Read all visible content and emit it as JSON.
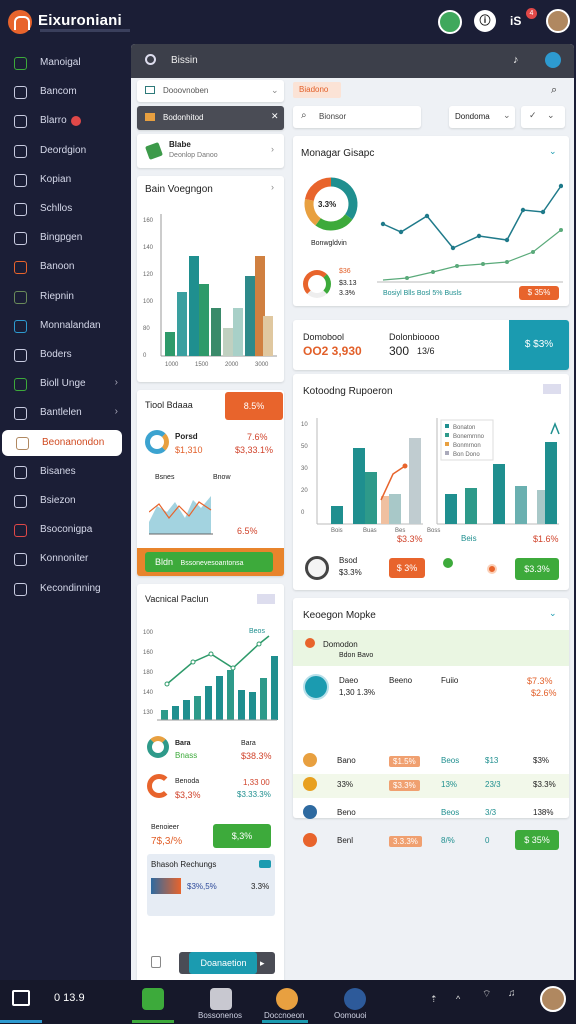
{
  "app": {
    "title": "Eixuroniani"
  },
  "topbar": {
    "notif_count": "4",
    "user_short": "iS"
  },
  "sidebar": {
    "items": [
      {
        "label": "Manoigal",
        "icon": "globe-icon"
      },
      {
        "label": "Bancom",
        "icon": "home-icon"
      },
      {
        "label": "Blarro",
        "icon": "clock-icon",
        "badge": true
      },
      {
        "label": "Deordgion",
        "icon": "pen-icon"
      },
      {
        "label": "Kopian",
        "icon": "document-icon"
      },
      {
        "label": "Schllos",
        "icon": "folder-icon"
      },
      {
        "label": "Bingpgen",
        "icon": "settings-icon"
      },
      {
        "label": "Banoon",
        "icon": "tag-icon"
      },
      {
        "label": "Riepnin",
        "icon": "image-icon"
      },
      {
        "label": "Monnalandan",
        "icon": "chat-icon"
      },
      {
        "label": "Boders",
        "icon": "calendar-icon"
      },
      {
        "label": "Bioll Unge",
        "icon": "leaf-icon",
        "chevron": true
      },
      {
        "label": "Bantlelen",
        "icon": "edit-icon",
        "chevron": true
      },
      {
        "label": "Beonanondon",
        "icon": "user-icon",
        "active": true
      },
      {
        "label": "Bisanes",
        "icon": "face-icon"
      },
      {
        "label": "Bsiezon",
        "icon": "bell-icon"
      },
      {
        "label": "Bsoconigpa",
        "icon": "cart-icon"
      },
      {
        "label": "Konnoniter",
        "icon": "chart-icon"
      },
      {
        "label": "Kecondinning",
        "icon": "share-icon"
      }
    ]
  },
  "search": {
    "placeholder": "Bissin"
  },
  "left": {
    "dropdown1": "Dooovnoben",
    "dropdown2": "Bodonhitod",
    "item": {
      "title": "Blabe",
      "sub": "Deonlop Danoo"
    },
    "chart1": {
      "title": "Bain Voegngon",
      "yticks": [
        "160",
        "140",
        "120",
        "100",
        "80",
        "0"
      ],
      "xticks": [
        "1000",
        "1500",
        "2000",
        "3000"
      ]
    },
    "card2": {
      "title": "Tiool Bdaaa",
      "tag": "8.5%",
      "name": "Porsd",
      "v1": "7.6%",
      "val": "$1,310",
      "v2": "$3,33.1%",
      "lbl1": "Bsnes",
      "lbl2": "Bnow",
      "pct": "6.5%",
      "btn_a": "Bldn",
      "btn_b": "Bssonevesoantonsa"
    },
    "card3": {
      "title": "Vacnical Paclun",
      "legend": "Beos",
      "yticks": [
        "100",
        "160",
        "180",
        "140",
        "130"
      ],
      "r1_label": "Bara",
      "r1_val": "Bnass",
      "r1_pct": "$38.3%",
      "r2_label": "Benoda",
      "r2_v": "1,33 00",
      "r2_val": "$3,3%",
      "r2_pct": "$3.33.3%",
      "r3_label": "Benoieer",
      "r3_val": "7$,3/%",
      "r3_btn": "$,3%",
      "sub_title": "Bhasoh Rechungs",
      "sub_v1": "$3%,5%",
      "sub_v2": "3.3%",
      "btn": "Doanaetion"
    }
  },
  "right": {
    "tab": "Biadono",
    "filter": "Dondoma",
    "search": "Bionsor",
    "card1": {
      "title": "Monagar Gisapc",
      "donut_pct": "3.3%",
      "donut_label": "Bonwgldvin",
      "mini_vals": [
        "$36",
        "$3.13",
        "3.3%"
      ],
      "legend": "Bosiyl Blls Bosl 5% Busls",
      "btn": "$ 35%"
    },
    "card2": {
      "l1": "Domobool",
      "v1": "OO2 3,930",
      "l2": "Dolonbioooo",
      "v2": "300",
      "v3": "13/6",
      "btn": "$ $3%"
    },
    "card3": {
      "title": "Kotoodng Rupoeron",
      "yticks": [
        "10",
        "50",
        "30",
        "20",
        "0"
      ],
      "xticks": [
        "Bois",
        "Buas",
        "Bes",
        "Boss"
      ],
      "legend": [
        "Bonaton",
        "Bonemrnno",
        "Bonmrnon",
        "Bon Dono"
      ],
      "pct_a": "$3.3%",
      "pct_b": "Beis",
      "pct_c": "$1.6%",
      "row": {
        "name": "Bsod",
        "val": "$3.3%",
        "btn1": "$ 3%",
        "btn2": "$3.3%"
      }
    },
    "card4": {
      "title": "Keoegon Mopke",
      "header": "Domodon",
      "sub": "Bdon Bavo",
      "row1": {
        "c1": "Daeo",
        "c2": "Beeno",
        "c3": "Fuiio",
        "c4": "$7.3%",
        "c5": "1,30 1.3%",
        "c6": "$2.6%"
      },
      "rows": [
        {
          "name": "Bano",
          "badge": "$1.5%",
          "v1": "Beos",
          "v2": "$13",
          "v3": "$3%"
        },
        {
          "name": "33%",
          "badge": "$3.3%",
          "v1": "13%",
          "v2": "23/3",
          "v3": "$3.3%"
        },
        {
          "name": "Beno",
          "v1": "Beos",
          "v2": "3/3",
          "v3": "138%"
        },
        {
          "name": "Benl",
          "badge": "3.3.3%",
          "v1": "8/%",
          "v2": "0",
          "btn": "$ 35%"
        }
      ]
    }
  },
  "taskbar": {
    "clock": "0 13.9",
    "items": [
      "Bossonenos",
      "Doccnoeon",
      "Oomouoi"
    ]
  },
  "colors": {
    "accent": "#e8642c",
    "teal": "#1f8f8f",
    "green": "#3daa3b",
    "sidebar": "#1b1e36"
  }
}
